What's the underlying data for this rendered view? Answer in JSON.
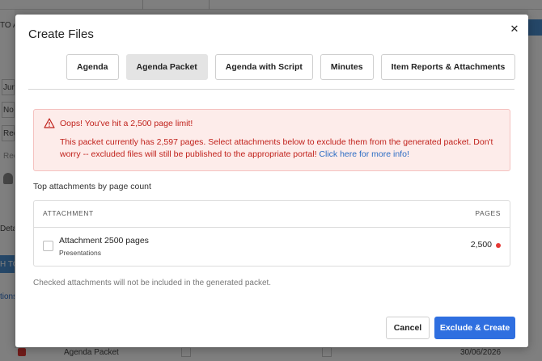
{
  "background": {
    "fragments": [
      "TO A",
      "Jun",
      "No",
      "Rec",
      "Rec",
      "Deta",
      "H TO",
      "tions",
      "Agenda Packet",
      "30/06/2026"
    ]
  },
  "modal": {
    "title": "Create Files",
    "close_icon": "close-icon",
    "tabs": [
      {
        "label": "Agenda",
        "active": false
      },
      {
        "label": "Agenda Packet",
        "active": true
      },
      {
        "label": "Agenda with Script",
        "active": false
      },
      {
        "label": "Minutes",
        "active": false
      },
      {
        "label": "Item Reports & Attachments",
        "active": false
      }
    ],
    "alert": {
      "icon": "warning-icon",
      "title": "Oops! You've hit a 2,500 page limit!",
      "body": "This packet currently has 2,597 pages. Select attachments below to exclude them from the generated packet. Don't worry -- excluded files will still be published to the appropriate portal! ",
      "link": "Click here for more info!"
    },
    "section_label": "Top attachments by page count",
    "table": {
      "headers": {
        "attachment": "ATTACHMENT",
        "pages": "PAGES"
      },
      "rows": [
        {
          "title": "Attachment 2500 pages",
          "subtitle": "Presentations",
          "pages": "2,500",
          "checked": false
        }
      ]
    },
    "note": "Checked attachments will not be included in the generated packet.",
    "buttons": {
      "cancel": "Cancel",
      "primary": "Exclude & Create"
    }
  },
  "colors": {
    "primary": "#2f6fe0",
    "alert_text": "#c0211b",
    "alert_bg": "#fdecea",
    "link": "#2b6cc4",
    "status_dot": "#e53935"
  }
}
